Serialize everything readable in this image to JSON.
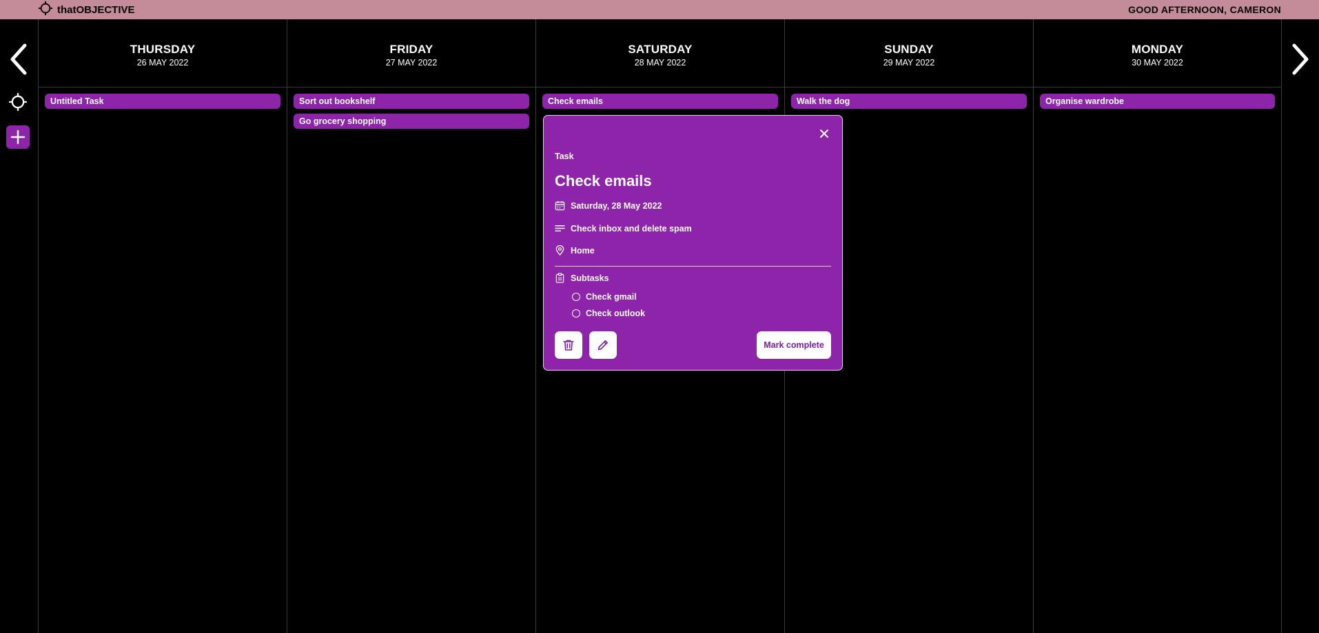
{
  "app": {
    "brand": "thatOBJECTIVE",
    "greeting": "GOOD AFTERNOON, CAMERON"
  },
  "icons": {
    "brand": "crosshair-icon",
    "prev": "chevron-left-icon",
    "next": "chevron-right-icon",
    "today": "crosshair-icon",
    "add": "plus-icon",
    "close": "close-icon",
    "date": "calendar-icon",
    "description": "text-lines-icon",
    "location": "location-pin-icon",
    "subtasks": "clipboard-icon",
    "delete": "trash-icon",
    "edit": "pencil-icon"
  },
  "colors": {
    "topbar": "#c48b98",
    "accent": "#8e24aa",
    "background": "#000000"
  },
  "columns": [
    {
      "day": "THURSDAY",
      "date": "26 MAY 2022",
      "tasks": [
        "Untitled Task"
      ]
    },
    {
      "day": "FRIDAY",
      "date": "27 MAY 2022",
      "tasks": [
        "Sort out bookshelf",
        "Go grocery shopping"
      ]
    },
    {
      "day": "SATURDAY",
      "date": "28 MAY 2022",
      "tasks": [
        "Check emails"
      ]
    },
    {
      "day": "SUNDAY",
      "date": "29 MAY 2022",
      "tasks": [
        "Walk the dog"
      ]
    },
    {
      "day": "MONDAY",
      "date": "30 MAY 2022",
      "tasks": [
        "Organise wardrobe"
      ]
    }
  ],
  "popup": {
    "type": "Task",
    "title": "Check emails",
    "date": "Saturday, 28 May 2022",
    "description": "Check inbox and delete spam",
    "location": "Home",
    "subtasks_label": "Subtasks",
    "subtasks": [
      "Check gmail",
      "Check outlook"
    ],
    "complete_label": "Mark complete"
  }
}
